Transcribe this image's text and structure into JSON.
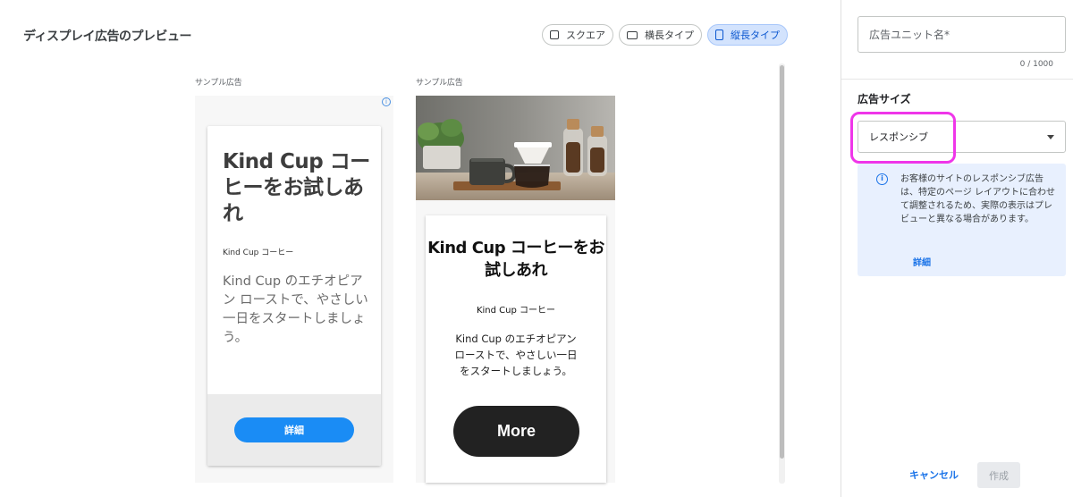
{
  "header": {
    "title": "ディスプレイ広告のプレビュー"
  },
  "toggles": [
    {
      "label": "スクエア",
      "icon": "square-icon",
      "active": false
    },
    {
      "label": "横長タイプ",
      "icon": "landscape-icon",
      "active": false
    },
    {
      "label": "縦長タイプ",
      "icon": "portrait-icon",
      "active": true
    }
  ],
  "ad1": {
    "label": "サンプル広告",
    "adchoices": "i",
    "headline": "Kind Cup コーヒーをお試しあれ",
    "brand": "Kind Cup コーヒー",
    "description": "Kind Cup のエチオピアン ローストで、やさしい一日をスタートしましょう。",
    "cta": "詳細",
    "cta_color": "#1a8cf5"
  },
  "ad2": {
    "label": "サンプル広告",
    "image_alt": "coffee-dripper-photo",
    "headline": "Kind Cup コーヒーをお試しあれ",
    "brand": "Kind Cup コーヒー",
    "description": "Kind Cup のエチオピアン ローストで、やさしい一日をスタートしましょう。",
    "cta": "More"
  },
  "panel": {
    "name_placeholder": "広告ユニット名*",
    "name_value": "",
    "counter": "0 / 1000",
    "size_label": "広告サイズ",
    "size_select": "レスポンシブ",
    "info_text": "お客様のサイトのレスポンシブ広告は、特定のページ レイアウトに合わせて調整されるため、実際の表示はプレビューと異なる場合があります。",
    "info_link": "詳細",
    "cancel": "キャンセル",
    "create": "作成",
    "highlight_color": "#ef36e9",
    "accent_color": "#1a73e8"
  }
}
